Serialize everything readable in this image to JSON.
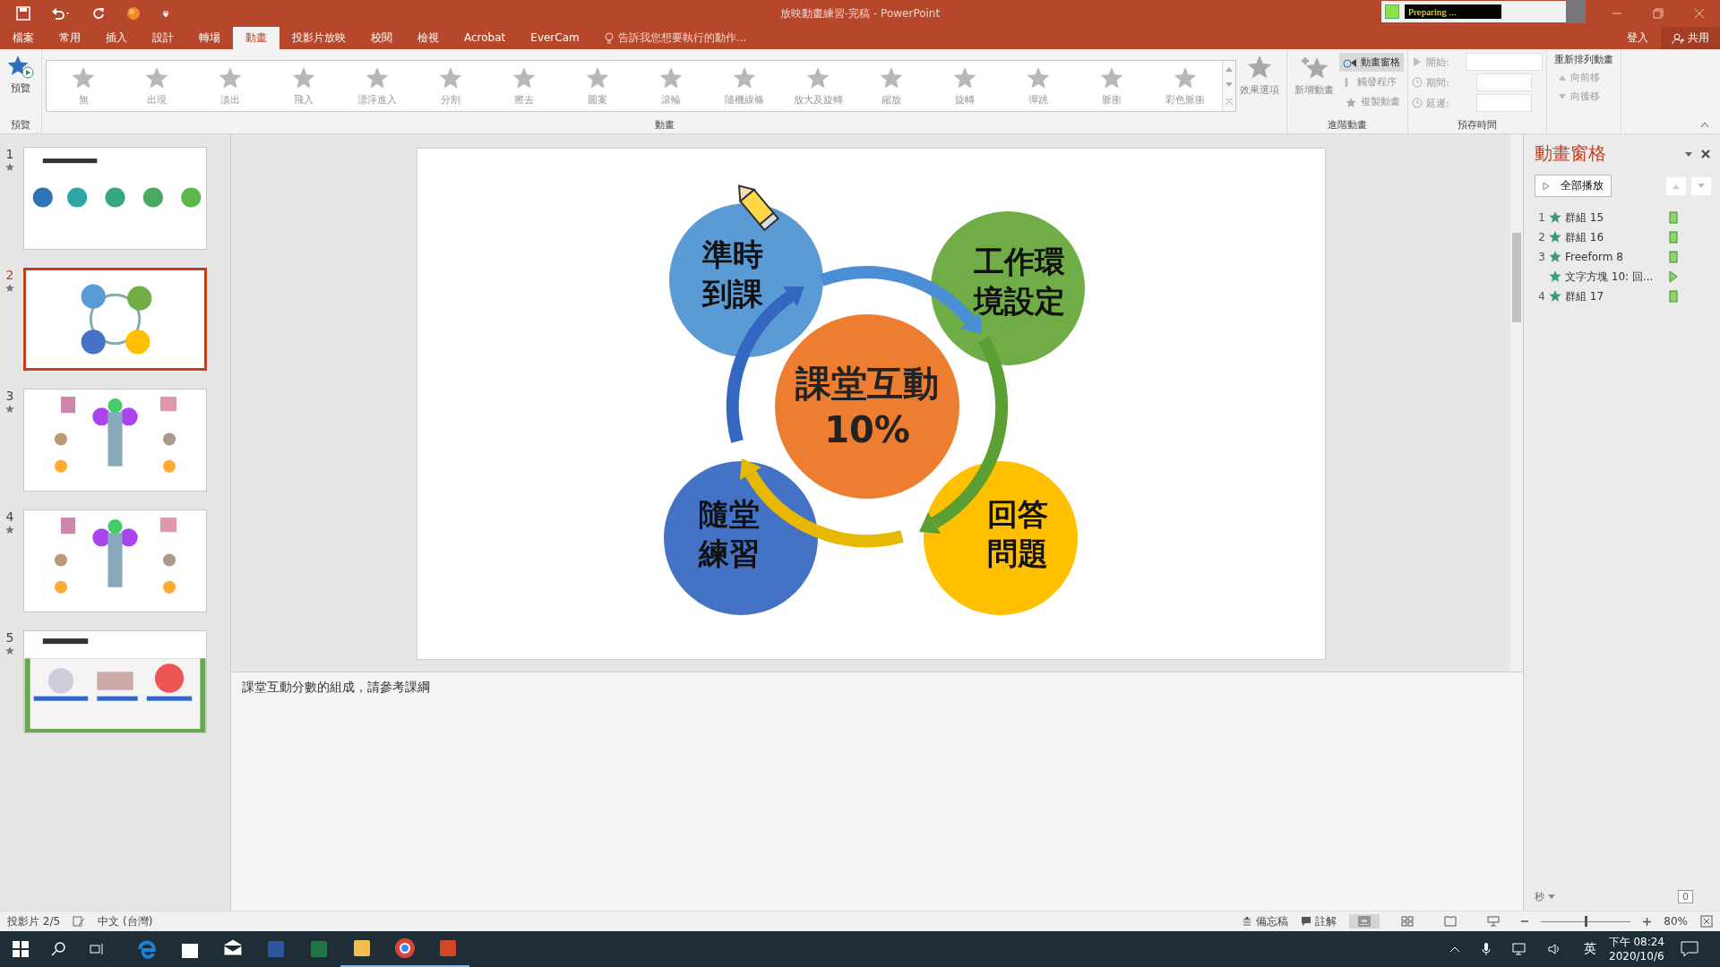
{
  "title_bar": {
    "title": "放映動畫練習-完稿 - PowerPoint",
    "status_popup": "Preparing ..."
  },
  "tabs": [
    {
      "label": "檔案",
      "selected": false
    },
    {
      "label": "常用",
      "selected": false
    },
    {
      "label": "插入",
      "selected": false
    },
    {
      "label": "設計",
      "selected": false
    },
    {
      "label": "轉場",
      "selected": false
    },
    {
      "label": "動畫",
      "selected": true
    },
    {
      "label": "投影片放映",
      "selected": false
    },
    {
      "label": "校閱",
      "selected": false
    },
    {
      "label": "檢視",
      "selected": false
    },
    {
      "label": "Acrobat",
      "selected": false
    },
    {
      "label": "EverCam",
      "selected": false
    }
  ],
  "tell_me": "告訴我您想要執行的動作...",
  "account": {
    "sign_in": "登入",
    "share": "共用"
  },
  "ribbon": {
    "preview": {
      "button": "預覽",
      "group": "預覽"
    },
    "animations": {
      "group": "動畫",
      "effect_options": "效果選項",
      "effects": [
        {
          "label": "無"
        },
        {
          "label": "出現"
        },
        {
          "label": "淡出"
        },
        {
          "label": "飛入"
        },
        {
          "label": "漂浮進入"
        },
        {
          "label": "分割"
        },
        {
          "label": "擦去"
        },
        {
          "label": "圖案"
        },
        {
          "label": "滾輪"
        },
        {
          "label": "隨機線條"
        },
        {
          "label": "放大及旋轉"
        },
        {
          "label": "縮放"
        },
        {
          "label": "旋轉"
        },
        {
          "label": "彈跳"
        },
        {
          "label": "脈衝"
        },
        {
          "label": "彩色脈衝"
        }
      ]
    },
    "advanced": {
      "group": "進階動畫",
      "add": "新增動畫",
      "pane": "動畫窗格",
      "trigger": "觸發程序",
      "painter": "複製動畫"
    },
    "timing": {
      "group": "預存時間",
      "start": "開始:",
      "duration": "期間:",
      "delay": "延遲:"
    },
    "reorder": {
      "title": "重新排列動畫",
      "earlier": "向前移",
      "later": "向後移"
    }
  },
  "thumbnails": [
    {
      "number": "1",
      "selected": false
    },
    {
      "number": "2",
      "selected": true
    },
    {
      "number": "3",
      "selected": false
    },
    {
      "number": "4",
      "selected": false
    },
    {
      "number": "5",
      "selected": false
    }
  ],
  "slide": {
    "center": [
      "課堂互動",
      "10%"
    ],
    "nodes": [
      {
        "lines": [
          "準時",
          "到課"
        ],
        "color": "#5b9bd5"
      },
      {
        "lines": [
          "工作環",
          "境設定"
        ],
        "color": "#70ad47"
      },
      {
        "lines": [
          "隨堂",
          "練習"
        ],
        "color": "#4472c4"
      },
      {
        "lines": [
          "回答",
          "問題"
        ],
        "color": "#ffc000"
      }
    ]
  },
  "notes": "課堂互動分數的組成，請參考課綱",
  "animation_pane": {
    "title": "動畫窗格",
    "play_all": "全部播放",
    "seconds": "秒",
    "page": "0",
    "items": [
      {
        "number": "1",
        "name": "群組 15",
        "kind": "on_click"
      },
      {
        "number": "2",
        "name": "群組 16",
        "kind": "on_click"
      },
      {
        "number": "3",
        "name": "Freeform 8",
        "kind": "on_click",
        "children": [
          {
            "name": "文字方塊 10: 回...",
            "kind": "after_previous"
          }
        ]
      },
      {
        "number": "4",
        "name": "群組 17",
        "kind": "on_click"
      }
    ]
  },
  "status_bar": {
    "slide": "投影片 2/5",
    "language": "中文 (台灣)",
    "notes": "備忘稿",
    "comments": "註解",
    "zoom": "80%",
    "zoom_slider": {
      "level": 0.5
    }
  },
  "taskbar": {
    "apps": [
      {
        "kind": "edge",
        "running": false
      },
      {
        "kind": "store",
        "running": false
      },
      {
        "kind": "mail",
        "running": false
      },
      {
        "kind": "word",
        "running": false
      },
      {
        "kind": "excel",
        "running": false
      },
      {
        "kind": "explorer",
        "running": true
      },
      {
        "kind": "chrome",
        "running": true
      },
      {
        "kind": "powerpoint",
        "running": true
      }
    ],
    "ime": "英",
    "time": "下午 08:24",
    "date": "2020/10/6"
  }
}
